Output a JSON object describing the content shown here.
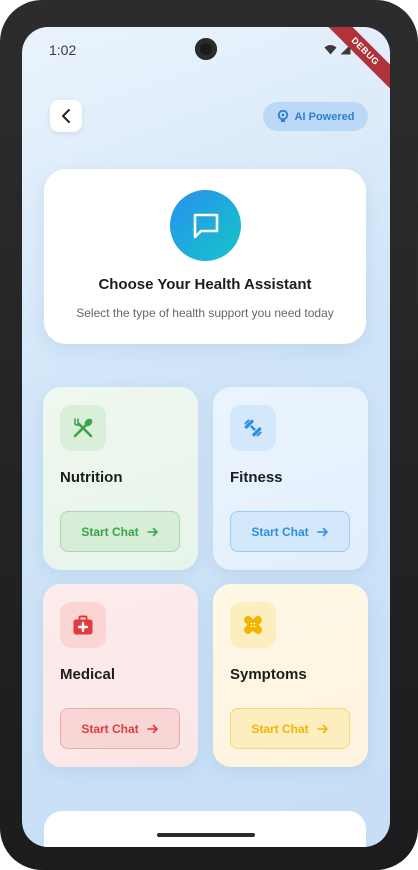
{
  "status": {
    "time": "1:02",
    "debug_label": "DEBUG"
  },
  "header": {
    "ai_badge": "AI Powered"
  },
  "hero": {
    "title": "Choose Your Health Assistant",
    "subtitle": "Select the type of health support you need today"
  },
  "cards": [
    {
      "title": "Nutrition",
      "button": "Start Chat",
      "icon": "fork-spoon-icon",
      "accent": "#3aa54a"
    },
    {
      "title": "Fitness",
      "button": "Start Chat",
      "icon": "dumbbell-icon",
      "accent": "#2d8ee0"
    },
    {
      "title": "Medical",
      "button": "Start Chat",
      "icon": "medical-kit-icon",
      "accent": "#e23b3b"
    },
    {
      "title": "Symptoms",
      "button": "Start Chat",
      "icon": "bandage-icon",
      "accent": "#f2b400"
    }
  ]
}
